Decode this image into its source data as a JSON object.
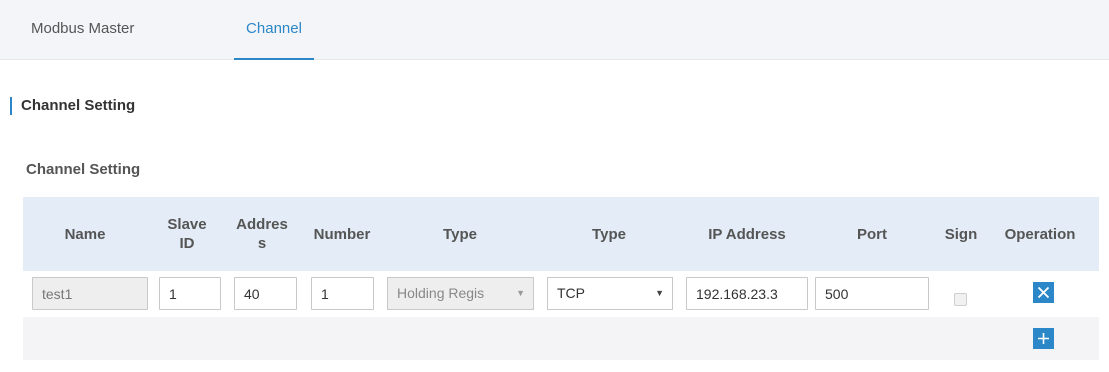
{
  "tabs": [
    {
      "label": "Modbus Master",
      "active": false
    },
    {
      "label": "Channel",
      "active": true
    }
  ],
  "section_title": "Channel Setting",
  "sub_title": "Channel Setting",
  "columns": {
    "name": "Name",
    "slave_id": "Slave ID",
    "address": "Addres s",
    "number": "Number",
    "type": "Type",
    "conn_type": "Type",
    "ip": "IP Address",
    "port": "Port",
    "sign": "Sign",
    "operation": "Operation"
  },
  "rows": [
    {
      "name": "test1",
      "slave_id": "1",
      "address": "40",
      "number": "1",
      "type": "Holding Regis",
      "conn_type": "TCP",
      "ip": "192.168.23.3",
      "port": "500",
      "sign": false
    }
  ],
  "icons": {
    "delete": "close-icon",
    "add": "plus-icon",
    "dropdown": "chevron-down-icon"
  },
  "colors": {
    "accent": "#2b87c8",
    "header_bg": "#e4edf7",
    "tabbar_bg": "#f4f5f8"
  }
}
